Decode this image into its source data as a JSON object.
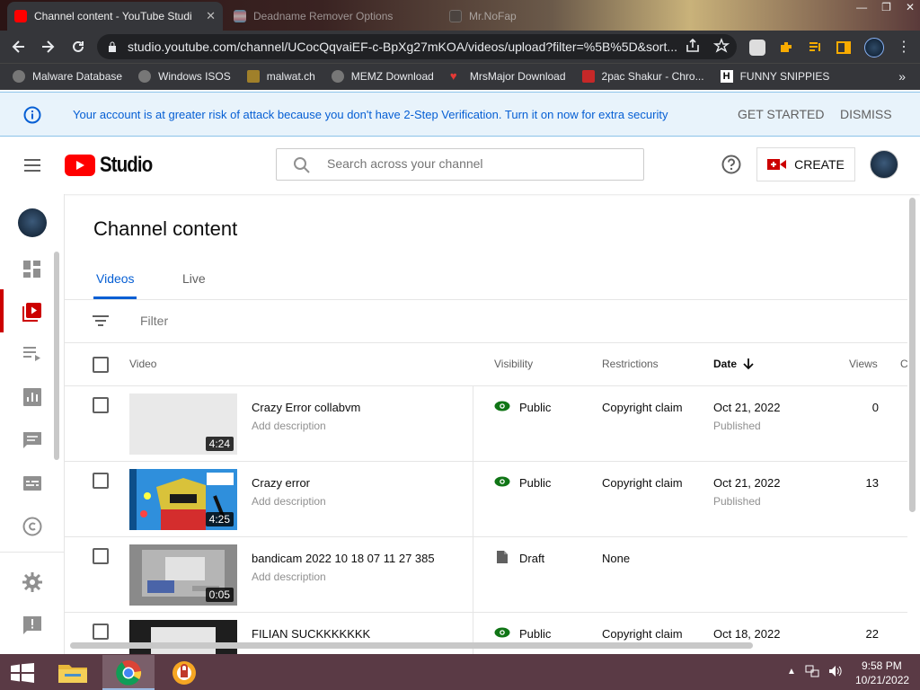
{
  "browser": {
    "tabs": [
      {
        "title": "Channel content - YouTube Studi",
        "active": true
      },
      {
        "title": "Deadname Remover Options",
        "active": false
      },
      {
        "title": "Mr.NoFap",
        "active": false
      }
    ],
    "url": "studio.youtube.com/channel/UCocQqvaiEF-c-BpXg27mKOA/videos/upload?filter=%5B%5D&sort...",
    "bookmarks": [
      "Malware Database",
      "Windows ISOS",
      "malwat.ch",
      "MEMZ Download",
      "MrsMajor Download",
      "2pac Shakur - Chro...",
      "FUNNY SNIPPIES"
    ],
    "bookmarks_more": "»"
  },
  "banner": {
    "text": "Your account is at greater risk of attack because you don't have 2-Step Verification. Turn it on now for extra security",
    "get_started": "GET STARTED",
    "dismiss": "DISMISS"
  },
  "header": {
    "logo_text": "Studio",
    "search_placeholder": "Search across your channel",
    "create_label": "CREATE"
  },
  "page": {
    "title": "Channel content",
    "tabs": [
      "Videos",
      "Live"
    ],
    "filter_label": "Filter"
  },
  "table": {
    "columns": {
      "video": "Video",
      "visibility": "Visibility",
      "restrictions": "Restrictions",
      "date": "Date",
      "views": "Views",
      "comments": "C"
    },
    "rows": [
      {
        "title": "Crazy Error collabvm",
        "description": "Add description",
        "duration": "4:24",
        "visibility": "Public",
        "restriction": "Copyright claim",
        "date": "Oct 21, 2022",
        "date_status": "Published",
        "views": "0"
      },
      {
        "title": "Crazy error",
        "description": "Add description",
        "duration": "4:25",
        "visibility": "Public",
        "restriction": "Copyright claim",
        "date": "Oct 21, 2022",
        "date_status": "Published",
        "views": "13"
      },
      {
        "title": "bandicam 2022 10 18 07 11 27 385",
        "description": "Add description",
        "duration": "0:05",
        "visibility": "Draft",
        "restriction": "None",
        "date": "",
        "date_status": "",
        "views": ""
      },
      {
        "title": "FILIAN SUCKKKKKKK",
        "description": "",
        "duration": "",
        "visibility": "Public",
        "restriction": "Copyright claim",
        "date": "Oct 18, 2022",
        "date_status": "",
        "views": "22"
      }
    ]
  },
  "taskbar": {
    "time": "9:58 PM",
    "date": "10/21/2022"
  },
  "colors": {
    "accent": "#065fd4",
    "youtube_red": "#ff0000",
    "studio_red": "#cc0000",
    "visibility_green": "#107516"
  }
}
